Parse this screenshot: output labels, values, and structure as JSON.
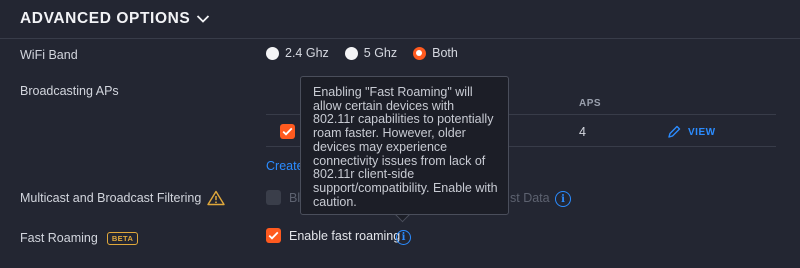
{
  "section": {
    "title": "ADVANCED OPTIONS"
  },
  "wifi_band": {
    "label": "WiFi Band",
    "options": [
      "2.4 Ghz",
      "5 Ghz",
      "Both"
    ],
    "selected": "Both"
  },
  "broadcasting": {
    "label": "Broadcasting APs",
    "column_aps": "APS",
    "row_aps_count": "4",
    "view_label": "VIEW",
    "create_link": "Create"
  },
  "multicast": {
    "label": "Multicast and Broadcast Filtering",
    "option_start": "Bl",
    "option_end": "st Data"
  },
  "fast_roaming": {
    "label": "Fast Roaming",
    "badge": "BETA",
    "checkbox_label": "Enable fast roaming"
  },
  "tooltip": {
    "text": "Enabling \"Fast Roaming\" will allow certain devices with 802.11r capabilities to potentially roam faster. However, older devices may experience connectivity issues from lack of 802.11r client-side support/compatibility. Enable with caution."
  },
  "colors": {
    "accent": "#ff5a1f",
    "link": "#2b8cff",
    "warning": "#e0a83b",
    "background": "#232632"
  }
}
